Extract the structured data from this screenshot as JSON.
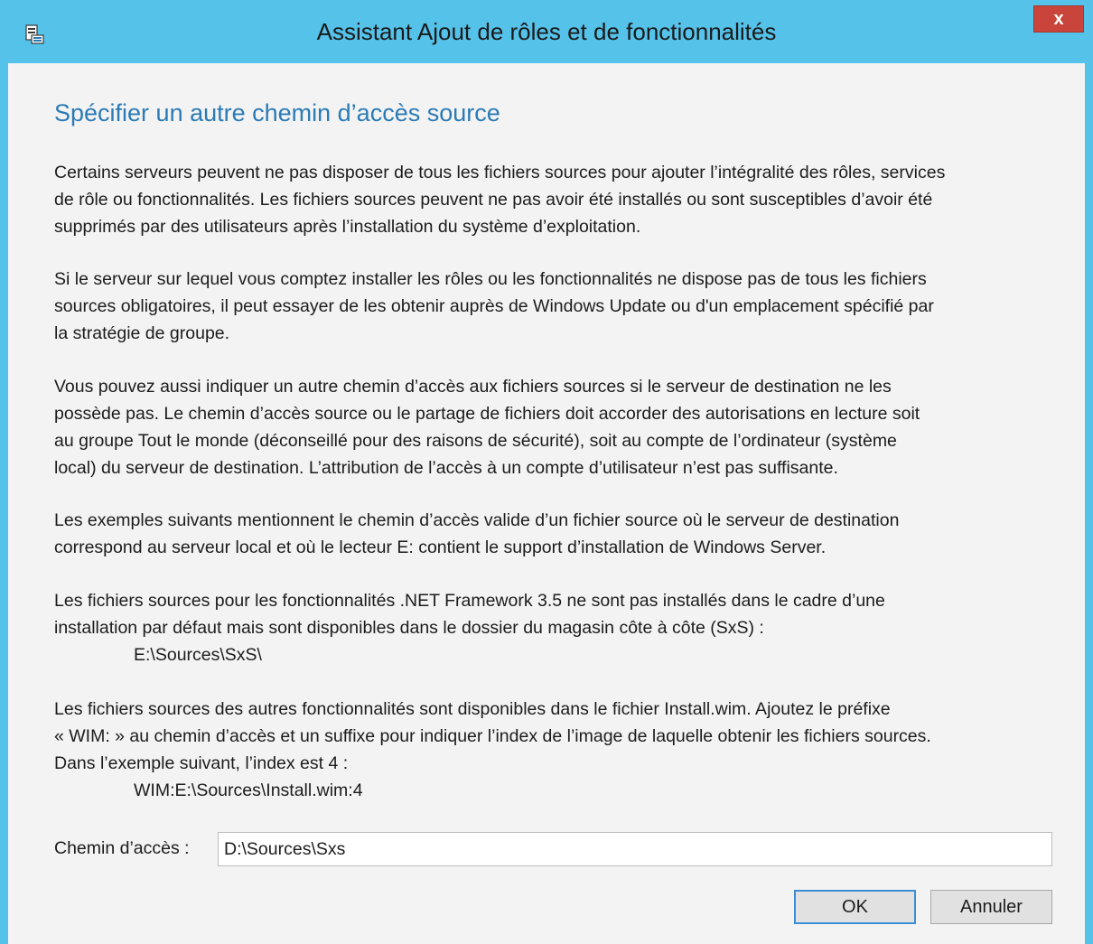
{
  "window": {
    "title": "Assistant Ajout de rôles et de fonctionnalités",
    "close_label": "x",
    "app_icon": "server-manager-icon",
    "colors": {
      "frame": "#55c2ea",
      "close": "#c9453b",
      "heading": "#2b7bb5",
      "background": "#f3f3f3"
    }
  },
  "dialog": {
    "heading": "Spécifier un autre chemin d’accès source",
    "paragraphs": [
      {
        "lines": [
          "Certains serveurs peuvent ne pas disposer de tous les fichiers sources pour ajouter l’intégralité des rôles, services",
          "de rôle ou fonctionnalités. Les fichiers sources peuvent ne pas avoir été installés ou sont susceptibles d’avoir été",
          "supprimés par des utilisateurs après l’installation du système d’exploitation."
        ]
      },
      {
        "lines": [
          "Si le serveur sur lequel vous comptez installer les rôles ou les fonctionnalités ne dispose pas de tous les fichiers",
          "sources obligatoires, il peut essayer de les obtenir auprès de Windows Update ou d'un emplacement spécifié par",
          "la stratégie de groupe."
        ]
      },
      {
        "lines": [
          "Vous pouvez aussi indiquer un autre chemin d’accès aux fichiers sources si le serveur de destination ne les",
          "possède pas. Le chemin d’accès source ou le partage de fichiers doit accorder des autorisations en lecture soit",
          "au groupe Tout le monde (déconseillé pour des raisons de sécurité), soit au compte de l’ordinateur (système",
          "local) du serveur de destination. L’attribution de l’accès à un compte d’utilisateur n’est pas suffisante."
        ]
      },
      {
        "lines": [
          "Les exemples suivants mentionnent le chemin d’accès valide d’un fichier source où le serveur de destination",
          "correspond au serveur local et où le lecteur E: contient le support d’installation de Windows Server."
        ]
      },
      {
        "lines": [
          "Les fichiers sources pour les fonctionnalités .NET Framework 3.5 ne sont pas installés dans le cadre d’une",
          "installation par défaut mais sont disponibles dans le dossier du magasin côte à côte (SxS) :"
        ],
        "code": "E:\\Sources\\SxS\\"
      },
      {
        "lines": [
          "Les fichiers sources des autres fonctionnalités sont disponibles dans le fichier Install.wim. Ajoutez le préfixe",
          "« WIM: » au chemin d’accès et un suffixe pour indiquer l’index de l’image de laquelle obtenir les fichiers sources.",
          "Dans l’exemple suivant, l’index est 4 :"
        ],
        "code": "WIM:E:\\Sources\\Install.wim:4"
      }
    ],
    "path_label": "Chemin d’accès :",
    "path_value": "D:\\Sources\\Sxs",
    "ok_label": "OK",
    "cancel_label": "Annuler"
  }
}
